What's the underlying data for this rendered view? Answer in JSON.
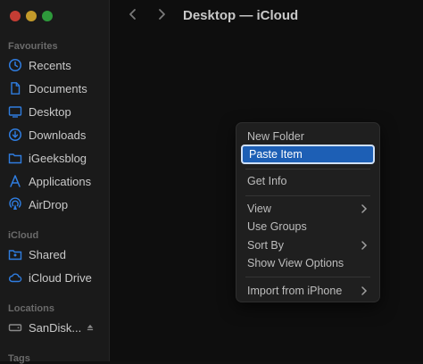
{
  "window": {
    "title": "Desktop — iCloud"
  },
  "sidebar": {
    "favourites_title": "Favourites",
    "icloud_title": "iCloud",
    "locations_title": "Locations",
    "tags_title": "Tags",
    "favourites": [
      {
        "label": "Recents",
        "icon": "clock-icon"
      },
      {
        "label": "Documents",
        "icon": "document-icon"
      },
      {
        "label": "Desktop",
        "icon": "desktop-icon"
      },
      {
        "label": "Downloads",
        "icon": "download-icon"
      },
      {
        "label": "iGeeksblog",
        "icon": "folder-icon"
      },
      {
        "label": "Applications",
        "icon": "applications-icon"
      },
      {
        "label": "AirDrop",
        "icon": "airdrop-icon"
      }
    ],
    "icloud": [
      {
        "label": "Shared",
        "icon": "shared-folder-icon"
      },
      {
        "label": "iCloud Drive",
        "icon": "cloud-icon"
      }
    ],
    "locations": [
      {
        "label": "SanDisk...",
        "icon": "drive-icon"
      }
    ]
  },
  "context_menu": {
    "items": [
      {
        "label": "New Folder"
      },
      {
        "label": "Paste Item",
        "selected": true
      },
      {
        "label": "Get Info"
      },
      {
        "label": "View",
        "submenu": true
      },
      {
        "label": "Use Groups"
      },
      {
        "label": "Sort By",
        "submenu": true
      },
      {
        "label": "Show View Options"
      },
      {
        "label": "Import from iPhone",
        "submenu": true
      }
    ]
  },
  "colors": {
    "accent": "#1d5fb5",
    "icon_blue": "#2f7de0",
    "background": "#0e0e0e"
  }
}
